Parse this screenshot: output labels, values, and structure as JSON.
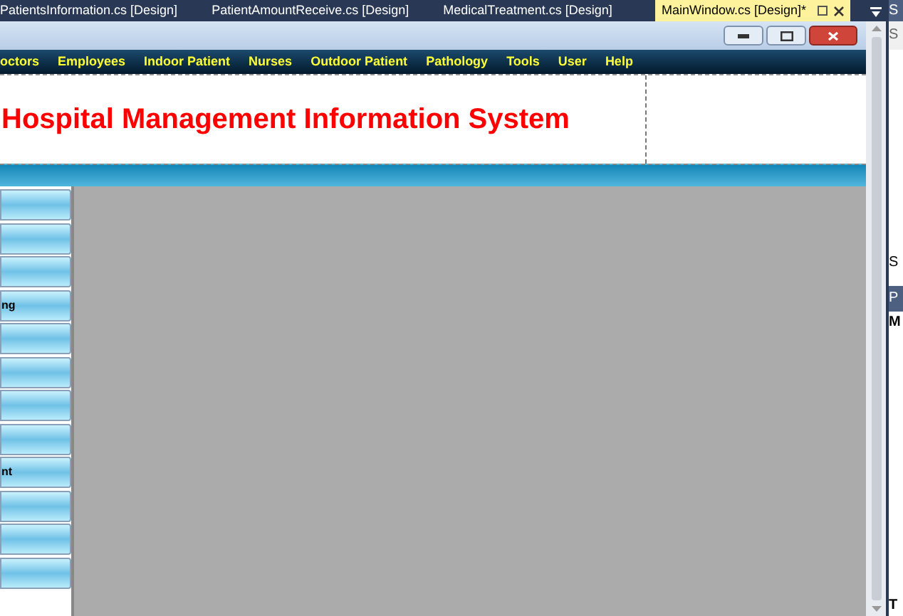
{
  "document_tabs": [
    {
      "label": "PatientsInformation.cs [Design]",
      "selected": false
    },
    {
      "label": "PatientAmountReceive.cs [Design]",
      "selected": false
    },
    {
      "label": "MedicalTreatment.cs [Design]",
      "selected": false
    },
    {
      "label": "MainWindow.cs [Design]*",
      "selected": true
    }
  ],
  "menu": [
    "octors",
    "Employees",
    "Indoor Patient",
    "Nurses",
    "Outdoor Patient",
    "Pathology",
    "Tools",
    "User",
    "Help"
  ],
  "header": {
    "title": "Hospital Management Information System"
  },
  "sidebar": {
    "buttons": [
      {
        "kind": "blank"
      },
      {
        "kind": "blank"
      },
      {
        "kind": "blank"
      },
      {
        "kind": "text",
        "label": "ng"
      },
      {
        "kind": "blank"
      },
      {
        "kind": "blank"
      },
      {
        "kind": "blank"
      },
      {
        "kind": "blank"
      },
      {
        "kind": "text",
        "label": "nt"
      },
      {
        "kind": "blank"
      },
      {
        "kind": "blank"
      },
      {
        "kind": "blank"
      }
    ]
  },
  "side_panel": {
    "texts": [
      "S",
      "S",
      "S",
      "P",
      "M",
      "T"
    ]
  }
}
